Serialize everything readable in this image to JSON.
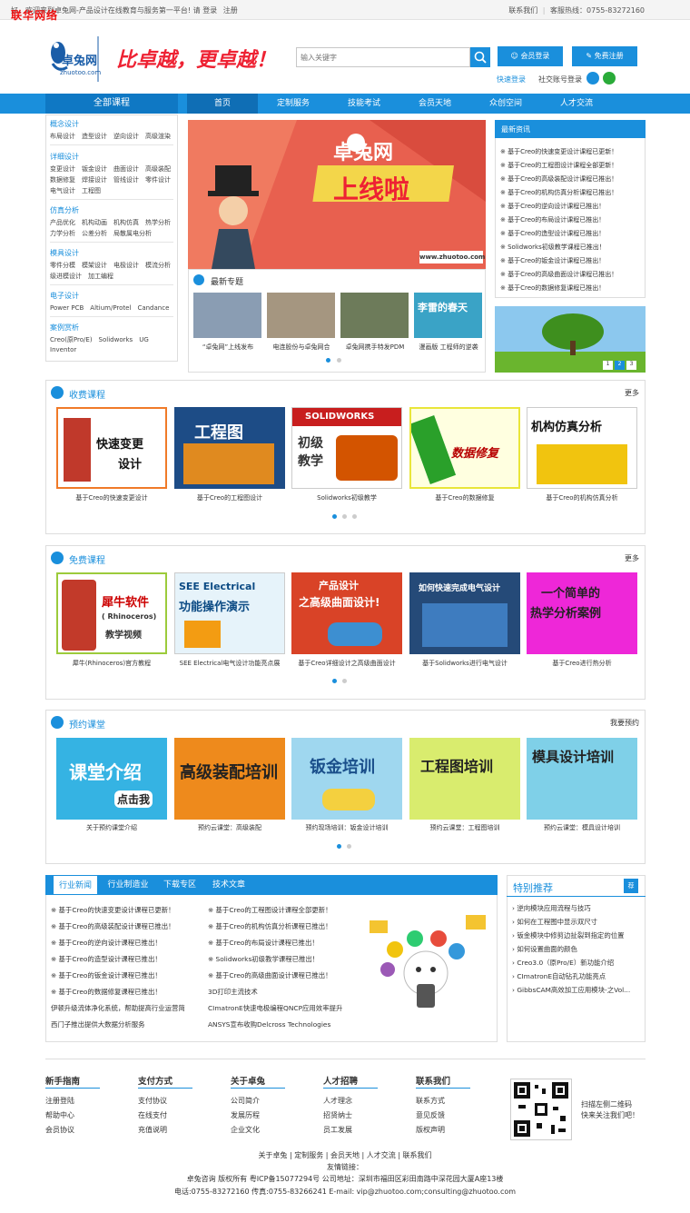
{
  "watermark": "联华网络",
  "topbar": {
    "welcome": "好，欢迎来到卓兔网-产品设计在线教育与服务第一平台! 请",
    "login": "登录",
    "register": "注册",
    "contact": "联系我们",
    "hotline": "客服热线：0755-83272160"
  },
  "header": {
    "logo_text": "卓兔网",
    "logo_sub": "zhuotoo.com",
    "slogan": "比卓越，更卓越！",
    "search_placeholder": "输入关键字",
    "member_login": "会员登录",
    "free_register": "免费注册",
    "quick_login": "快速登录",
    "social_login": "社交账号登录"
  },
  "nav": {
    "all_courses": "全部课程",
    "items": [
      "首页",
      "定制服务",
      "技能考试",
      "会员天地",
      "众创空间",
      "人才交流"
    ]
  },
  "sidebar": [
    {
      "title": "概念设计",
      "lines": [
        "布局设计　造型设计　逆向设计　高级渲染"
      ]
    },
    {
      "title": "详细设计",
      "lines": [
        "变更设计　钣金设计　曲面设计　高级装配",
        "数据修复　焊接设计　管线设计　零件设计",
        "电气设计　工程图"
      ]
    },
    {
      "title": "仿真分析",
      "lines": [
        "产品优化　机构动画　机构仿真　热学分析",
        "力学分析　公差分析　局散属电分析"
      ]
    },
    {
      "title": "模具设计",
      "lines": [
        "零件分模　模架设计　电极设计　模流分析",
        "级进模设计　加工编程"
      ]
    },
    {
      "title": "电子设计",
      "lines": [
        "Power PCB　Altium/Protel　Candance"
      ]
    },
    {
      "title": "案例赏析",
      "lines": [
        "Creo(原Pro/E)　Solidworks　UG",
        "Inventor"
      ]
    }
  ],
  "banner": {
    "brand": "卓兔网",
    "headline": "上线啦",
    "url": "www.zhuotoo.com"
  },
  "topics": {
    "title": "最新专题",
    "items": [
      "“卓兔网”上线发布",
      "电连股份与卓兔网合",
      "卓兔网携手特发PDM",
      "漫画版 工程师的逆袭"
    ],
    "thumb_text": "李雷的春天"
  },
  "news": {
    "title": "最新资讯",
    "items": [
      "※ 基于Creo的快速变更设计课程已更新！",
      "※ 基于Creo的工程图设计课程全部更新！",
      "※ 基于Creo的高级装配设计课程已推出！",
      "※ 基于Creo的机构仿真分析课程已推出！",
      "※ 基于Creo的逆向设计课程已推出！",
      "※ 基于Creo的布局设计课程已推出！",
      "※ 基于Creo的造型设计课程已推出！",
      "※ Solidworks初级教学课程已推出！",
      "※ 基于Creo的钣金设计课程已推出！",
      "※ 基于Creo的高级曲面设计课程已推出！",
      "※ 基于Creo的数据修复课程已推出！"
    ],
    "pager": [
      "1",
      "2",
      "3"
    ]
  },
  "paid": {
    "title": "收费课程",
    "more": "更多",
    "cards": [
      {
        "caption": "基于Creo的快速变更设计",
        "art": [
          "快速变更",
          "设计"
        ]
      },
      {
        "caption": "基于Creo的工程图设计",
        "art": [
          "工程图"
        ]
      },
      {
        "caption": "Solidworks初级教学",
        "art": [
          "SOLIDWORKS",
          "初级",
          "教学"
        ]
      },
      {
        "caption": "基于Creo的数据修复",
        "art": [
          "数据修复"
        ]
      },
      {
        "caption": "基于Creo的机构仿真分析",
        "art": [
          "机构仿真分析"
        ]
      }
    ]
  },
  "free": {
    "title": "免费课程",
    "more": "更多",
    "cards": [
      {
        "caption": "犀牛(Rhinoceros)官方教程",
        "art": [
          "犀牛软件",
          "( Rhinoceros)",
          "教学视频"
        ]
      },
      {
        "caption": "SEE Electrical电气设计功能亮点展",
        "art": [
          "SEE Electrical",
          "功能操作演示"
        ]
      },
      {
        "caption": "基于Creo详细设计之高级曲面设计",
        "art": [
          "产品设计",
          "之高级曲面设计!"
        ]
      },
      {
        "caption": "基于Solidworks进行电气设计",
        "art": [
          "如何快速完成电气设计"
        ]
      },
      {
        "caption": "基于Creo进行热分析",
        "art": [
          "一个简单的",
          "热学分析案例"
        ]
      }
    ]
  },
  "booking": {
    "title": "预约课堂",
    "more": "我要预约",
    "cards": [
      {
        "caption": "关于预约课堂介绍",
        "art": [
          "课堂介绍",
          "点击我"
        ]
      },
      {
        "caption": "预约云课堂：高级装配",
        "art": [
          "高级装配培训"
        ]
      },
      {
        "caption": "预约现场培训：钣金设计培训",
        "art": [
          "钣金培训"
        ]
      },
      {
        "caption": "预约云课堂：工程图培训",
        "art": [
          "工程图培训"
        ]
      },
      {
        "caption": "预约云课堂：模具设计培训",
        "art": [
          "模具设计培训"
        ]
      }
    ]
  },
  "bottom_news": {
    "tabs": [
      "行业新闻",
      "行业制造业",
      "下载专区",
      "技术文章"
    ],
    "left": [
      "※ 基于Creo的快速变更设计课程已更新！",
      "※ 基于Creo的高级装配设计课程已推出！",
      "※ 基于Creo的逆向设计课程已推出！",
      "※ 基于Creo的造型设计课程已推出！",
      "※ 基于Creo的钣金设计课程已推出！",
      "※ 基于Creo的数据修复课程已推出！",
      "伊顿升级流体净化系统，帮助提高行业运营简",
      "西门子推出提供大数据分析服务"
    ],
    "right": [
      "※ 基于Creo的工程图设计课程全部更新！",
      "※ 基于Creo的机构仿真分析课程已推出！",
      "※ 基于Creo的布局设计课程已推出！",
      "※ Solidworks初级教学课程已推出！",
      "※ 基于Creo的高级曲面设计课程已推出！",
      "3D打印主流技术",
      "CImatronE快速电极编程QNCP应用效率提升",
      "ANSYS宣布收购Delcross Technologies"
    ]
  },
  "special": {
    "title": "特别推荐",
    "badge": "荐",
    "items": [
      "逆向模块应用流程与技巧",
      "如何在工程图中显示双尺寸",
      "钣金模块中修剪边扯裂到指定的位置",
      "如何设置曲面的颜色",
      "Creo3.0（原Pro/E）新功能介绍",
      "CImatronE自动钻孔功能亮点",
      "GibbsCAM高效加工应用模块-之Vol..."
    ]
  },
  "footer": {
    "columns": [
      {
        "title": "新手指南",
        "links": [
          "注册登陆",
          "帮助中心",
          "会员协议"
        ]
      },
      {
        "title": "支付方式",
        "links": [
          "支付协议",
          "在线支付",
          "充值说明"
        ]
      },
      {
        "title": "关于卓兔",
        "links": [
          "公司简介",
          "发展历程",
          "企业文化"
        ]
      },
      {
        "title": "人才招聘",
        "links": [
          "人才理念",
          "招贤纳士",
          "员工发展"
        ]
      },
      {
        "title": "联系我们",
        "links": [
          "联系方式",
          "意见反馈",
          "版权声明"
        ]
      }
    ],
    "qr_text": [
      "扫描左侧二维码",
      "快来关注我们吧！"
    ],
    "bottom_links": "关于卓兔 | 定制服务 | 会员天地 | 人才交流 | 联系我们",
    "friend_links": "友情链接：",
    "copyright": "卓兔咨询  版权所有  粤ICP备15077294号  公司地址：深圳市福田区彩田南路中深花园大厦A座13楼",
    "contact": "电话:0755-83272160  传真:0755-83266241  E-mail: vip@zhuotoo.com;consulting@zhuotoo.com"
  }
}
